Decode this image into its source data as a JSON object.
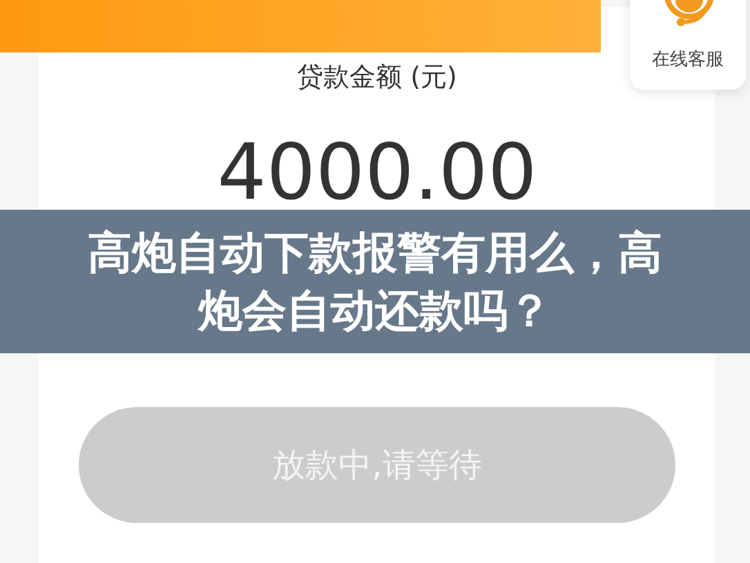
{
  "support": {
    "label": "在线客服"
  },
  "loan": {
    "label": "贷款金额 (元)",
    "amount": "4000.00"
  },
  "button": {
    "label": "放款中,请等待",
    "disabled": true
  },
  "banner": {
    "title": "高炮自动下款报警有用么，高炮会自动还款吗？"
  }
}
